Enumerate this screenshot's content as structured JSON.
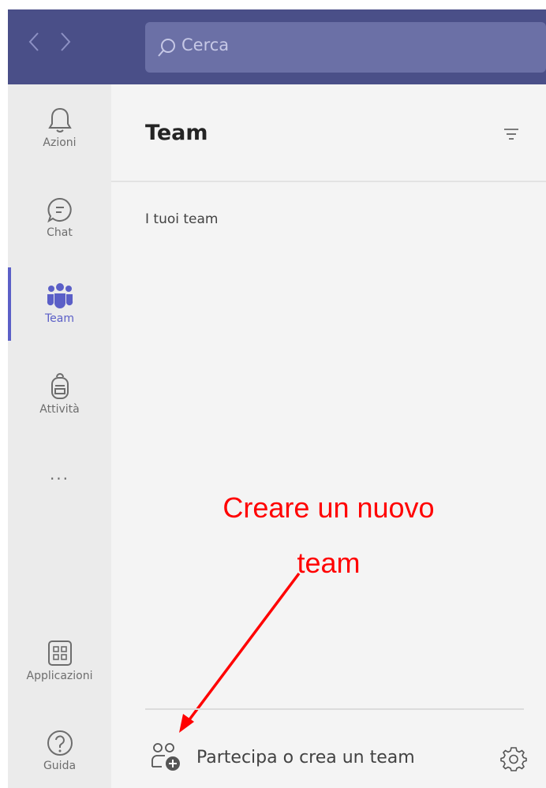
{
  "search": {
    "placeholder": "Cerca"
  },
  "rail": {
    "items": [
      {
        "label": "Azioni",
        "icon": "bell-icon"
      },
      {
        "label": "Chat",
        "icon": "chat-icon"
      },
      {
        "label": "Team",
        "icon": "teams-icon",
        "active": true
      },
      {
        "label": "Attività",
        "icon": "backpack-icon"
      },
      {
        "label": "Applicazioni",
        "icon": "apps-icon"
      },
      {
        "label": "Guida",
        "icon": "help-icon"
      }
    ],
    "more_label": "..."
  },
  "panel": {
    "title": "Team",
    "section_label": "I tuoi team",
    "join_label": "Partecipa o crea un team"
  },
  "annotation": {
    "line1": "Creare un nuovo",
    "line2": "team",
    "color": "#ff0000"
  },
  "colors": {
    "topbar": "#4a4f88",
    "search_bg": "#6b70a6",
    "accent": "#5b5fc7",
    "rail_bg": "#ebebeb",
    "panel_bg": "#f4f4f4"
  }
}
